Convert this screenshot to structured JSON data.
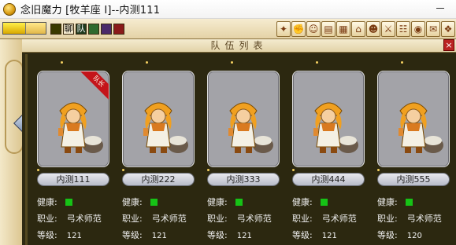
{
  "window": {
    "title": "念旧魔力   [牧羊座 I]--内测111"
  },
  "toolbar": {
    "letters": [
      "聊",
      "队"
    ],
    "colors": {
      "yellow": "#f2c200",
      "dark": "#3a3a00",
      "green": "#2f6a2f",
      "purple": "#4a2a6a",
      "red": "#8a1a1a"
    },
    "buttons": [
      "skill",
      "fist",
      "people",
      "card",
      "map",
      "home",
      "group",
      "sword",
      "book",
      "eye",
      "mail",
      "pet"
    ]
  },
  "panel": {
    "title": "队伍列表",
    "leader_label": "队长"
  },
  "labels": {
    "health": "健康:",
    "job": "职业:",
    "level": "等级:"
  },
  "members": [
    {
      "name": "内测111",
      "job": "弓术师范",
      "level": "121",
      "healthy": true,
      "leader": true
    },
    {
      "name": "内测222",
      "job": "弓术师范",
      "level": "121",
      "healthy": true,
      "leader": false
    },
    {
      "name": "内测333",
      "job": "弓术师范",
      "level": "121",
      "healthy": true,
      "leader": false
    },
    {
      "name": "内测444",
      "job": "弓术师范",
      "level": "121",
      "healthy": true,
      "leader": false
    },
    {
      "name": "内测555",
      "job": "弓术师范",
      "level": "120",
      "healthy": true,
      "leader": false
    }
  ]
}
